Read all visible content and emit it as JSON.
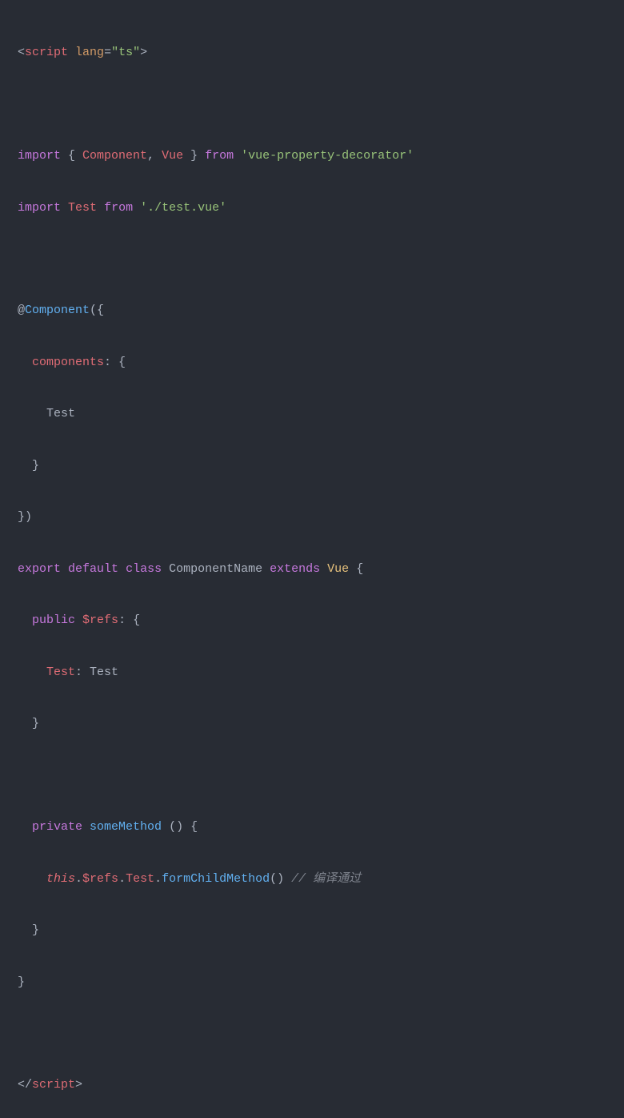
{
  "code": {
    "line1": {
      "open": "<",
      "tag": "script",
      "sp1": " ",
      "attr": "lang",
      "eq": "=",
      "val": "\"ts\"",
      "close": ">"
    },
    "line2": "",
    "line3": {
      "kw1": "import",
      "sp1": " { ",
      "id1": "Component",
      "comma": ", ",
      "id2": "Vue",
      "sp2": " } ",
      "kw2": "from",
      "sp3": " ",
      "str": "'vue-property-decorator'"
    },
    "line4": {
      "kw1": "import",
      "sp1": " ",
      "id1": "Test",
      "sp2": " ",
      "kw2": "from",
      "sp3": " ",
      "str": "'./test.vue'"
    },
    "line5": "",
    "line6": {
      "at": "@",
      "dec": "Component",
      "paren": "({"
    },
    "line7": {
      "indent": "  ",
      "key": "components",
      "colon": ": {"
    },
    "line8": {
      "indent": "    ",
      "id": "Test"
    },
    "line9": {
      "indent": "  ",
      "close": "}"
    },
    "line10": {
      "close": "})"
    },
    "line11": {
      "kw1": "export",
      "sp1": " ",
      "kw2": "default",
      "sp2": " ",
      "kw3": "class",
      "sp3": " ",
      "name": "ComponentName",
      "sp4": " ",
      "kw4": "extends",
      "sp5": " ",
      "ext": "Vue",
      "sp6": " {"
    },
    "line12": {
      "indent": "  ",
      "kw": "public",
      "sp": " ",
      "id": "$refs",
      "colon": ": {"
    },
    "line13": {
      "indent": "    ",
      "key": "Test",
      "colon": ": ",
      "type": "Test"
    },
    "line14": {
      "indent": "  ",
      "close": "}"
    },
    "line15": "",
    "line16": {
      "indent": "  ",
      "kw": "private",
      "sp": " ",
      "name": "someMethod",
      "sp2": " ",
      "paren": "() {"
    },
    "line17": {
      "indent": "    ",
      "this": "this",
      "dot1": ".",
      "refs": "$refs",
      "dot2": ".",
      "test": "Test",
      "dot3": ".",
      "method": "formChildMethod",
      "paren": "()",
      "sp": " ",
      "comment": "// 编译通过"
    },
    "line18": {
      "indent": "  ",
      "close": "}"
    },
    "line19": {
      "close": "}"
    },
    "line20": "",
    "line21": {
      "open": "</",
      "tag": "script",
      "close": ">"
    }
  }
}
